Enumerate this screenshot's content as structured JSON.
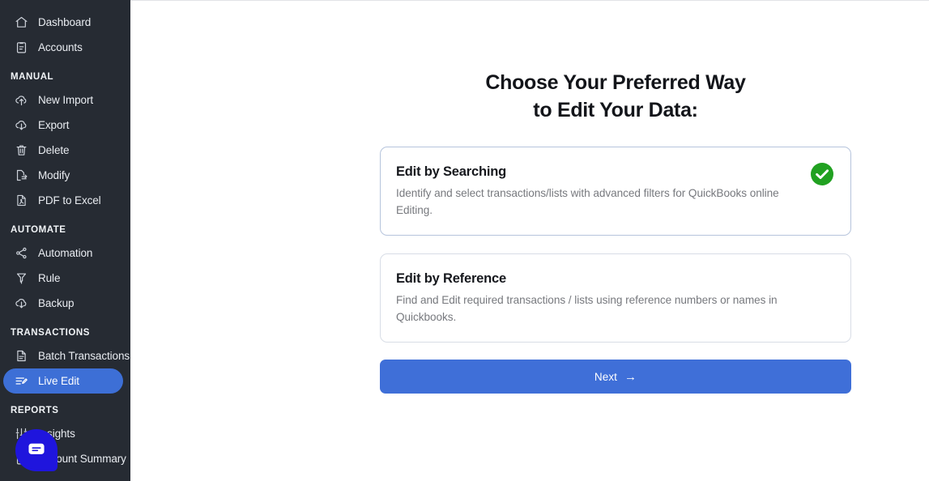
{
  "colors": {
    "sidebar_bg": "#262b33",
    "accent_blue": "#3f6fd8",
    "active_item_blue": "#3d6fd6",
    "success_green": "#21a121",
    "chat_launcher_blue": "#1f15dd",
    "page_bg": "#ffffff",
    "title_text": "#13151a",
    "muted_text": "#77797e"
  },
  "sidebar": {
    "groups": [
      {
        "heading": null,
        "items": [
          {
            "label": "Dashboard",
            "icon": "home-icon",
            "active": false
          },
          {
            "label": "Accounts",
            "icon": "clipboard-icon",
            "active": false
          }
        ]
      },
      {
        "heading": "MANUAL",
        "items": [
          {
            "label": "New Import",
            "icon": "cloud-upload-icon",
            "active": false
          },
          {
            "label": "Export",
            "icon": "cloud-download-icon",
            "active": false
          },
          {
            "label": "Delete",
            "icon": "trash-icon",
            "active": false
          },
          {
            "label": "Modify",
            "icon": "file-edit-icon",
            "active": false
          },
          {
            "label": "PDF to Excel",
            "icon": "file-pdf-icon",
            "active": false
          }
        ]
      },
      {
        "heading": "AUTOMATE",
        "items": [
          {
            "label": "Automation",
            "icon": "share-nodes-icon",
            "active": false
          },
          {
            "label": "Rule",
            "icon": "funnel-rule-icon",
            "active": false
          },
          {
            "label": "Backup",
            "icon": "cloud-download-icon",
            "active": false
          }
        ]
      },
      {
        "heading": "TRANSACTIONS",
        "items": [
          {
            "label": "Batch Transactions",
            "icon": "document-icon",
            "active": false
          },
          {
            "label": "Live Edit",
            "icon": "edit-lines-icon",
            "active": true
          }
        ]
      },
      {
        "heading": "REPORTS",
        "items": [
          {
            "label": "Insights",
            "icon": "sliders-icon",
            "active": false
          },
          {
            "label": "Account Summary",
            "icon": "clipboard-icon",
            "active": false
          }
        ]
      }
    ],
    "chat_launcher": {
      "icon": "chat-bubble-icon"
    }
  },
  "main": {
    "title_line1": "Choose Your Preferred Way",
    "title_line2": "to Edit Your Data:",
    "options": [
      {
        "title": "Edit by Searching",
        "description": "Identify and select transactions/lists with advanced filters for QuickBooks online Editing.",
        "selected": true,
        "badge_icon": "check-circle-icon"
      },
      {
        "title": "Edit by Reference",
        "description": "Find and Edit required transactions / lists using reference numbers or names in Quickbooks.",
        "selected": false,
        "badge_icon": null
      }
    ],
    "next_button": {
      "label": "Next",
      "icon": "arrow-right-icon",
      "glyph": "→"
    }
  }
}
